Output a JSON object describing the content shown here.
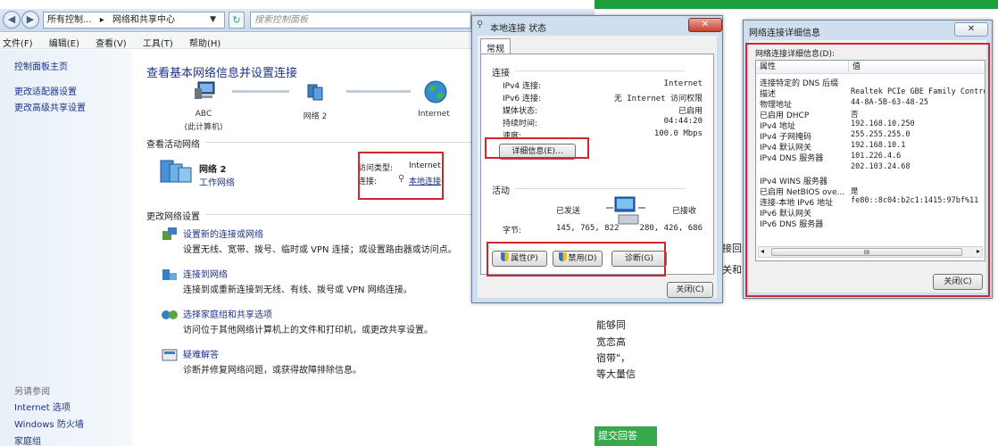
{
  "explorer": {
    "address": {
      "crumb1": "所有控制...",
      "crumb2": "网络和共享中心"
    },
    "search_placeholder": "搜索控制面板",
    "menu": [
      "文件(F)",
      "编辑(E)",
      "查看(V)",
      "工具(T)",
      "帮助(H)"
    ],
    "sidebar": {
      "items": [
        "控制面板主页",
        "更改适配器设置",
        "更改高级共享设置"
      ],
      "see_also": "另请参阅",
      "see_also_items": [
        "Internet 选项",
        "Windows 防火墙",
        "家庭组"
      ]
    },
    "title": "查看基本网络信息并设置连接",
    "map": {
      "pc_name": "ABC",
      "pc_sub": "(此计算机)",
      "network": "网络 2",
      "internet": "Internet"
    },
    "active_header": "查看活动网络",
    "active": {
      "name": "网络 2",
      "type_link": "工作网络",
      "access_label": "访问类型:",
      "access_value": "Internet",
      "conn_label": "连接:",
      "conn_value": "本地连接"
    },
    "change_header": "更改网络设置",
    "tasks": [
      {
        "link": "设置新的连接或网络",
        "desc": "设置无线、宽带、拨号、临时或 VPN 连接；或设置路由器或访问点。"
      },
      {
        "link": "连接到网络",
        "desc": "连接到或重新连接到无线、有线、拨号或 VPN 网络连接。"
      },
      {
        "link": "选择家庭组和共享选项",
        "desc": "访问位于其他网络计算机上的文件和打印机，或更改共享设置。"
      },
      {
        "link": "疑难解答",
        "desc": "诊断并修复网络问题，或获得故障排除信息。"
      }
    ]
  },
  "web": {
    "lines": [
      "能够同",
      "宽恋高",
      "宿带\"，",
      "等大量信"
    ],
    "frag1": "接回",
    "frag2": "关和",
    "button": "提交回答"
  },
  "status": {
    "title": "本地连接 状态",
    "close": "✕",
    "tab": "常规",
    "conn_group": "连接",
    "rows": [
      {
        "k": "IPv4 连接:",
        "v": "Internet"
      },
      {
        "k": "IPv6 连接:",
        "v": "无 Internet 访问权限"
      },
      {
        "k": "媒体状态:",
        "v": "已启用"
      },
      {
        "k": "持续时间:",
        "v": "04:44:20"
      },
      {
        "k": "速度:",
        "v": "100.0 Mbps"
      }
    ],
    "details_btn": "详细信息(E)...",
    "activity_group": "活动",
    "sent": "已发送",
    "received": "已接收",
    "bytes_label": "字节:",
    "bytes_sent": "145, 765, 822",
    "bytes_recv": "280, 426, 686",
    "props_btn": "属性(P)",
    "disable_btn": "禁用(D)",
    "diag_btn": "诊断(G)",
    "close_btn": "关闭(C)"
  },
  "details": {
    "title": "网络连接详细信息",
    "label": "网络连接详细信息(D):",
    "col_prop": "属性",
    "col_val": "值",
    "rows": [
      {
        "p": "连接特定的 DNS 后缀",
        "v": ""
      },
      {
        "p": "描述",
        "v": "Realtek PCIe GBE Family Controlle"
      },
      {
        "p": "物理地址",
        "v": "44-8A-5B-63-48-25"
      },
      {
        "p": "已启用 DHCP",
        "v": "否"
      },
      {
        "p": "IPv4 地址",
        "v": "192.168.10.250"
      },
      {
        "p": "IPv4 子网掩码",
        "v": "255.255.255.0"
      },
      {
        "p": "IPv4 默认网关",
        "v": "192.168.10.1"
      },
      {
        "p": "IPv4 DNS 服务器",
        "v": "101.226.4.6"
      },
      {
        "p": "",
        "v": "202.103.24.68"
      },
      {
        "p": "IPv4 WINS 服务器",
        "v": ""
      },
      {
        "p": "已启用 NetBIOS ove...",
        "v": "是"
      },
      {
        "p": "连接-本地 IPv6 地址",
        "v": "fe80::8c04:b2c1:1415:97bf%11"
      },
      {
        "p": "IPv6 默认网关",
        "v": ""
      },
      {
        "p": "IPv6 DNS 服务器",
        "v": ""
      }
    ],
    "scroll_grip": "III",
    "close_btn": "关闭(C)"
  },
  "colors": {
    "link": "#1e3287",
    "highlight": "#d3272c",
    "dialog": "#cfdfef"
  }
}
